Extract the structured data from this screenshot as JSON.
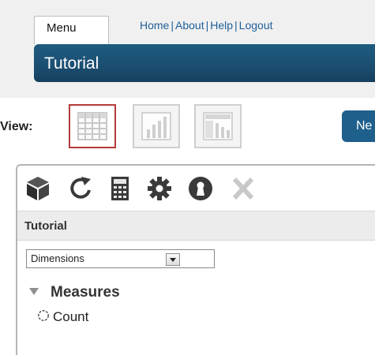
{
  "header": {
    "menu_tab": "Menu",
    "links": [
      "Home",
      "About",
      "Help",
      "Logout"
    ],
    "link_separator": "|",
    "title": "Tutorial",
    "banner_color": "#1b4f72"
  },
  "view": {
    "label": "View:",
    "buttons": [
      {
        "name": "table-view",
        "icon": "grid-icon",
        "selected": true
      },
      {
        "name": "chart-view",
        "icon": "bar-chart-icon",
        "selected": false
      },
      {
        "name": "layout-view",
        "icon": "layout-icon",
        "selected": false
      }
    ],
    "new_button_partial": "Ne"
  },
  "toolbar": {
    "icons": [
      "cube-icon",
      "refresh-icon",
      "calculator-icon",
      "gear-icon",
      "lock-icon",
      "close-icon"
    ]
  },
  "panel": {
    "title": "Tutorial",
    "dimensions_select": "Dimensions",
    "tree": {
      "group": "Measures",
      "items": [
        "Count"
      ]
    }
  },
  "colors": {
    "selected_border": "#b33a3a",
    "icon_dark": "#3a3a3a",
    "icon_disabled": "#c8c8c8",
    "link": "#1f5f9a"
  }
}
